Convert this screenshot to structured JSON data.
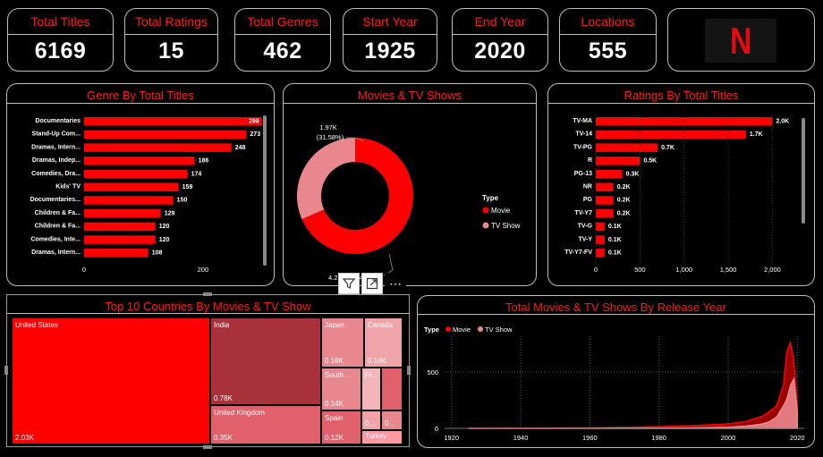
{
  "kpis": [
    {
      "label": "Total Titles",
      "value": "6169"
    },
    {
      "label": "Total Ratings",
      "value": "15"
    },
    {
      "label": "Total Genres",
      "value": "462"
    },
    {
      "label": "Start Year",
      "value": "1925"
    },
    {
      "label": "End Year",
      "value": "2020"
    },
    {
      "label": "Locations",
      "value": "555"
    }
  ],
  "logo": {
    "letter": "N"
  },
  "toolbar": {
    "filter_icon": "filter-icon",
    "focus_icon": "focus-mode-icon",
    "more_label": "⋯"
  },
  "colors": {
    "accent": "#ff0000",
    "movie": "#ff0000",
    "tv": "#e8878d",
    "panel_border": "#bdbdbd"
  },
  "chart_data": [
    {
      "type": "bar",
      "title": "Genre By Total Titles",
      "categories": [
        "Documentaries",
        "Stand-Up Com...",
        "Dramas, Intern...",
        "Dramas, Indep...",
        "Comedies, Dra...",
        "Kids' TV",
        "Documentaries...",
        "Children & Fa...",
        "Children & Fa...",
        "Comedies, Inte...",
        "Dramas, Intern..."
      ],
      "values": [
        299,
        273,
        248,
        186,
        174,
        159,
        150,
        129,
        120,
        120,
        108
      ],
      "data_labels": [
        "299",
        "273",
        "248",
        "186",
        "174",
        "159",
        "150",
        "129",
        "120",
        "120",
        "108"
      ],
      "xticks": [
        "0",
        "200"
      ],
      "xlim": [
        0,
        310
      ]
    },
    {
      "type": "pie",
      "title": "Movies & TV Shows",
      "legend_title": "Type",
      "labels": [
        "Movie",
        "TV Show"
      ],
      "values": [
        68.42,
        31.58
      ],
      "data_labels": [
        "4.27K (68.42%)",
        "1.97K (31.58%)"
      ],
      "label_lines": {
        "tv": [
          "1.97K",
          "(31.58%)"
        ],
        "movie": "4.27K (68.42%)"
      }
    },
    {
      "type": "bar",
      "title": "Ratings By Total Titles",
      "categories": [
        "TV-MA",
        "TV-14",
        "TV-PG",
        "R",
        "PG-13",
        "NR",
        "PG",
        "TV-Y7",
        "TV-G",
        "TV-Y",
        "TV-Y7-FV"
      ],
      "values": [
        2000,
        1700,
        700,
        500,
        300,
        200,
        200,
        200,
        100,
        100,
        100
      ],
      "data_labels": [
        "2.0K",
        "1.7K",
        "0.7K",
        "0.5K",
        "0.3K",
        "0.2K",
        "0.2K",
        "0.2K",
        "0.1K",
        "0.1K",
        "0.1K"
      ],
      "xticks": [
        "0",
        "500",
        "1,000",
        "1,500",
        "2,000"
      ],
      "xlim": [
        0,
        2350
      ]
    },
    {
      "type": "heatmap",
      "title": "Top 10 Countries By Movies & TV Show",
      "cells": [
        {
          "name": "United States",
          "label": "2.03K",
          "value": 2030
        },
        {
          "name": "India",
          "label": "0.78K",
          "value": 780
        },
        {
          "name": "United Kingdom",
          "label": "0.35K",
          "value": 350
        },
        {
          "name": "Japan",
          "label": "0.18K",
          "value": 180
        },
        {
          "name": "Canada",
          "label": "0.14K",
          "value": 140
        },
        {
          "name": "South ...",
          "label": "0.14K",
          "value": 140
        },
        {
          "name": "Fr...",
          "label": "",
          "value": 110
        },
        {
          "name": "",
          "label": "",
          "value": 100
        },
        {
          "name": "Spain",
          "label": "0.12K",
          "value": 120
        },
        {
          "name": "",
          "label": "0...",
          "value": 90
        },
        {
          "name": "",
          "label": "0...",
          "value": 90
        },
        {
          "name": "Turkey",
          "label": "",
          "value": 90
        }
      ]
    },
    {
      "type": "area",
      "title": "Total Movies & TV Shows By Release Year",
      "legend_title": "Type",
      "series": [
        {
          "name": "Movie",
          "x": [
            1925,
            1940,
            1960,
            1970,
            1980,
            1990,
            2000,
            2005,
            2010,
            2012,
            2014,
            2016,
            2017,
            2018,
            2019,
            2020
          ],
          "values": [
            1,
            2,
            5,
            10,
            15,
            25,
            40,
            60,
            110,
            150,
            200,
            380,
            680,
            760,
            600,
            200
          ]
        },
        {
          "name": "TV Show",
          "x": [
            1925,
            1940,
            1960,
            1970,
            1980,
            1990,
            2000,
            2005,
            2010,
            2012,
            2014,
            2016,
            2017,
            2018,
            2019,
            2020
          ],
          "values": [
            0,
            0,
            1,
            2,
            3,
            5,
            10,
            20,
            40,
            60,
            100,
            200,
            260,
            380,
            440,
            150
          ]
        }
      ],
      "xticks": [
        "1920",
        "1940",
        "1960",
        "1980",
        "2000",
        "2020"
      ],
      "yticks": [
        "0",
        "500"
      ],
      "xlim": [
        1918,
        2022
      ],
      "ylim": [
        0,
        850
      ]
    }
  ]
}
